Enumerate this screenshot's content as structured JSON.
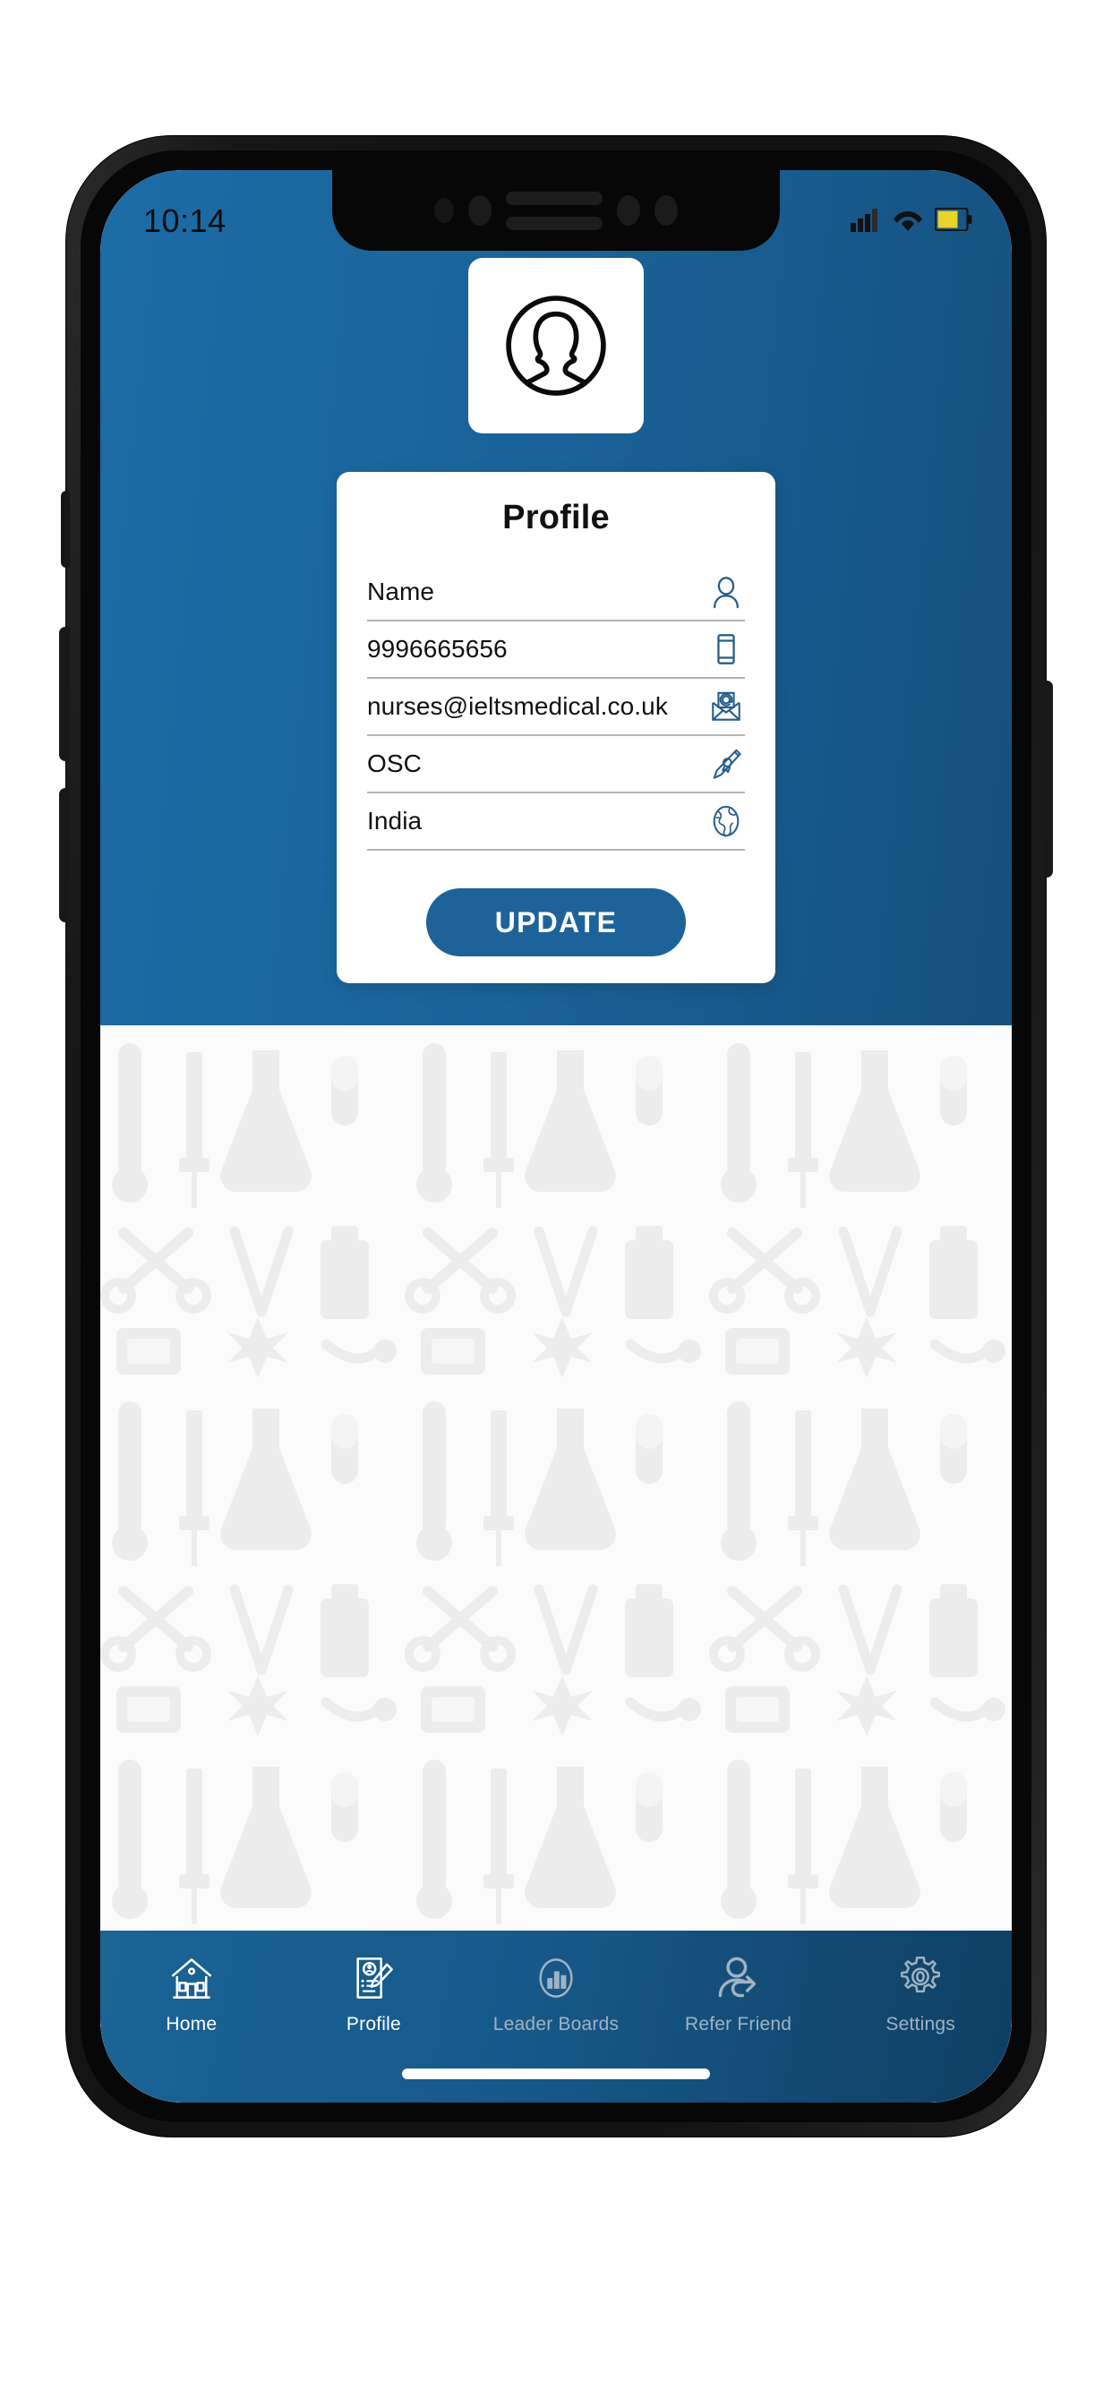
{
  "device": {
    "type": "smartphone-mockup",
    "buttons": [
      "silent-switch",
      "volume-up",
      "volume-down",
      "power"
    ]
  },
  "statusbar": {
    "time": "10:14",
    "icons": [
      "signal-icon",
      "wifi-icon",
      "battery-icon"
    ],
    "battery_color": "#e8d32a"
  },
  "theme": {
    "brand_blue": "#1a6298",
    "brand_blue_dark": "#0f3f63",
    "icon_blue": "#255d8a",
    "button_blue": "#1d6399",
    "card_white": "#ffffff",
    "divider_gray": "#b4b4b4",
    "nav_inactive": "#9fb3c2",
    "nav_active": "#ffffff"
  },
  "avatar": {
    "icon": "user-portrait-icon",
    "alt": "Profile picture placeholder"
  },
  "card": {
    "title": "Profile",
    "fields": [
      {
        "name": "name",
        "value": "Name",
        "icon": "person-icon"
      },
      {
        "name": "phone",
        "value": "9996665656",
        "icon": "mobile-phone-icon"
      },
      {
        "name": "email",
        "value": "nurses@ieltsmedical.co.uk",
        "icon": "email-at-icon"
      },
      {
        "name": "course",
        "value": "OSC",
        "icon": "diploma-icon"
      },
      {
        "name": "country",
        "value": "India",
        "icon": "globe-icon"
      }
    ],
    "update_label": "UPDATE"
  },
  "bottom_nav": {
    "items": [
      {
        "label": "Home",
        "icon": "home-icon",
        "state": "bright"
      },
      {
        "label": "Profile",
        "icon": "profile-doc-icon",
        "state": "active"
      },
      {
        "label": "Leader Boards",
        "icon": "bar-chart-icon",
        "state": "inactive"
      },
      {
        "label": "Refer Friend",
        "icon": "person-share-icon",
        "state": "inactive"
      },
      {
        "label": "Settings",
        "icon": "gear-icon",
        "state": "inactive"
      }
    ]
  },
  "background": {
    "pattern": "medical-equipment-pattern",
    "description": "Faint grayscale medical tools: thermometers, syringes, flasks, scissors, tweezers, pill bottles, star-of-life"
  }
}
